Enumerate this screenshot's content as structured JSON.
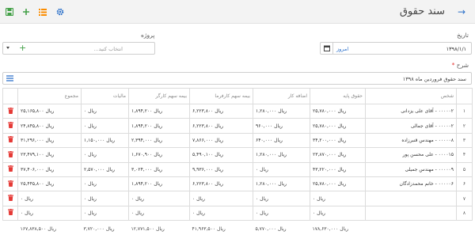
{
  "header": {
    "title": "سند حقوق",
    "back_icon": "arrow-right-icon",
    "toolbar_icons": [
      "settings-icon",
      "list-icon",
      "add-icon",
      "save-icon"
    ]
  },
  "form": {
    "date_label": "تاریخ",
    "date_value": "۱۳۹۸/۱/۱",
    "today_label": "امروز",
    "project_label": "پروژه",
    "project_placeholder": "انتخاب کنید...",
    "description_label": "شرح",
    "required_mark": "*",
    "description_value": "سند حقوق فروردین ماه ۱۳۹۸"
  },
  "table": {
    "headers": [
      "",
      "شخص",
      "حقوق پایه",
      "اضافه کار",
      "بیمه سهم کارفرما",
      "بیمه سهم کارگر",
      "مالیات",
      "مجموع",
      ""
    ],
    "rows": [
      {
        "idx": "۱",
        "person": "۰۰۰۰۰۲ - آقای علی یزدانی",
        "base": "ریال ۲۵,۷۸۰,۰۰۰",
        "overtime": "ریال ۱,۲۸۰,۰۰۰",
        "emp_ins": "ریال ۶,۲۲۳,۸۰۰",
        "work_ins": "ریال ۱,۸۹۴,۲۰۰",
        "tax": "ریال ۰",
        "total": "ریال ۲۵,۱۶۵,۸۰۰"
      },
      {
        "idx": "۲",
        "person": "۰۰۰۰۰۲ - آقای جمالی",
        "base": "ریال ۲۵,۷۸۰,۰۰۰",
        "overtime": "ریال ۹۶۰,۰۰۰",
        "emp_ins": "ریال ۶,۲۲۳,۸۰۰",
        "work_ins": "ریال ۱,۸۹۴,۲۰۰",
        "tax": "ریال ۰",
        "total": "ریال ۲۴,۸۴۵,۸۰۰"
      },
      {
        "idx": "۳",
        "person": "۰۰۰۰۰۸ - مهندس قنبرزاده",
        "base": "ریال ۳۴,۲۰۰,۰۰۰",
        "overtime": "ریال ۶۴۰,۰۰۰",
        "emp_ins": "ریال ۷,۸۶۶,۰۰۰",
        "work_ins": "ریال ۲,۳۹۴,۰۰۰",
        "tax": "ریال ۱,۱۵۰,۰۰۰",
        "total": "ریال ۳۱,۲۹۶,۰۰۰"
      },
      {
        "idx": "۴",
        "person": "۰۰۰۰۱۵ - علی محسن پور",
        "base": "ریال ۲۳,۸۷۰,۰۰۰",
        "overtime": "ریال ۱,۲۸۰,۰۰۰",
        "emp_ins": "ریال ۵,۴۹۰,۱۰۰",
        "work_ins": "ریال ۱,۶۷۰,۹۰۰",
        "tax": "ریال ۰",
        "total": "ریال ۲۳,۴۷۹,۱۰۰"
      },
      {
        "idx": "۵",
        "person": "۰۰۰۰۰۹ - مهندس جمیلی",
        "base": "ریال ۴۳,۲۲۰,۰۰۰",
        "overtime": "ریال ۰",
        "emp_ins": "ریال ۹,۹۳۶,۰۰۰",
        "work_ins": "ریال ۳,۰۲۴,۰۰۰",
        "tax": "ریال ۲,۵۷۰,۰۰۰",
        "total": "ریال ۳۷,۴۰۶,۰۰۰"
      },
      {
        "idx": "۶",
        "person": "۰۰۰۰۰۶ - خانم محمدزادگان",
        "base": "ریال ۲۵,۷۸۰,۰۰۰",
        "overtime": "ریال ۱,۲۸۰,۰۰۰",
        "emp_ins": "ریال ۶,۲۲۳,۸۰۰",
        "work_ins": "ریال ۱,۸۹۴,۲۰۰",
        "tax": "ریال ۰",
        "total": "ریال ۲۵,۴۴۵,۸۰۰"
      },
      {
        "idx": "۷",
        "person": "",
        "base": "ریال ۰",
        "overtime": "ریال ۰",
        "emp_ins": "ریال ۰",
        "work_ins": "ریال ۰",
        "tax": "ریال ۰",
        "total": "ریال ۰"
      },
      {
        "idx": "۸",
        "person": "",
        "base": "ریال ۰",
        "overtime": "ریال ۰",
        "emp_ins": "ریال ۰",
        "work_ins": "ریال ۰",
        "tax": "ریال ۰",
        "total": "ریال ۰"
      }
    ],
    "totals": {
      "base": "ریال ۱۷۸,۶۳۰,۰۰۰",
      "overtime": "ریال ۵,۷۷۰,۰۰۰",
      "emp_ins": "ریال ۴۱,۹۶۳,۵۰۰",
      "work_ins": "ریال ۱۲,۷۷۱,۵۰۰",
      "tax": "ریال ۳,۷۲۰,۰۰۰",
      "total": "ریال ۱۶۷,۸۳۸,۵۰۰"
    }
  },
  "colors": {
    "accent": "#2a6fc9",
    "delete": "#e53935",
    "save": "#43a047",
    "list": "#fb8c00"
  }
}
